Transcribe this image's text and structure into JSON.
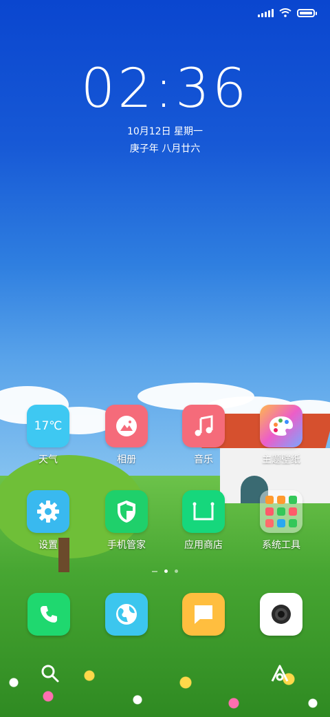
{
  "status_bar": {
    "signal": "signal-icon",
    "wifi": "wifi-icon",
    "battery": "battery-icon"
  },
  "clock": {
    "time": "02:36",
    "date": "10月12日 星期一",
    "lunar": "庚子年 八月廿六"
  },
  "home_apps": [
    {
      "label": "天气",
      "icon": "weather-icon",
      "temp": "17℃",
      "color": "#3ec8f2"
    },
    {
      "label": "相册",
      "icon": "gallery-icon",
      "color": "#f56b7a"
    },
    {
      "label": "音乐",
      "icon": "music-icon",
      "color": "#f56b7a"
    },
    {
      "label": "主题壁纸",
      "icon": "themes-icon",
      "color": "#e85ed6"
    },
    {
      "label": "设置",
      "icon": "settings-icon",
      "color": "#39b9ef"
    },
    {
      "label": "手机管家",
      "icon": "security-icon",
      "color": "#1fd06b"
    },
    {
      "label": "应用商店",
      "icon": "app-store-icon",
      "color": "#16d77c"
    },
    {
      "label": "系统工具",
      "icon": "folder-icon",
      "color": "#ffffff"
    }
  ],
  "page_indicator": {
    "pages": 2,
    "active": 1
  },
  "dock": [
    {
      "name": "phone",
      "icon": "phone-icon",
      "color": "#1fd86f"
    },
    {
      "name": "browser",
      "icon": "browser-icon",
      "color": "#3cc6ee"
    },
    {
      "name": "messages",
      "icon": "messages-icon",
      "color": "#ffbe3f"
    },
    {
      "name": "camera",
      "icon": "camera-icon",
      "color": "#ffffff"
    }
  ]
}
